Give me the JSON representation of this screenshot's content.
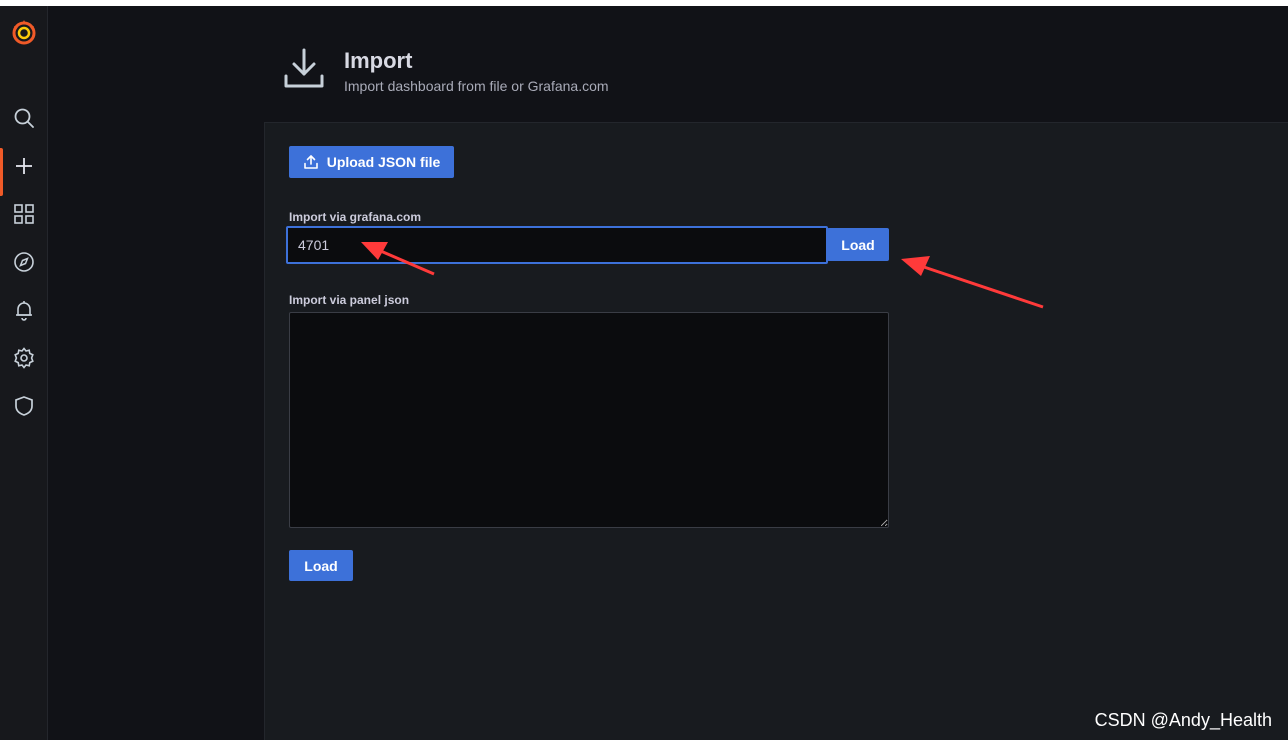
{
  "sidebar": {
    "icons": [
      "grafana-logo",
      "search-icon",
      "plus-icon",
      "dashboards-icon",
      "explore-icon",
      "alerting-icon",
      "configuration-icon",
      "shield-icon"
    ],
    "accent_color": "#f05a28"
  },
  "header": {
    "title": "Import",
    "subtitle": "Import dashboard from file or Grafana.com"
  },
  "upload": {
    "label": "Upload JSON file"
  },
  "grafana_com": {
    "label": "Import via grafana.com",
    "value": "4701",
    "load_label": "Load"
  },
  "panel_json": {
    "label": "Import via panel json",
    "value": "",
    "load_label": "Load"
  },
  "colors": {
    "primary_button": "#3d71d9",
    "annotation_arrow": "#ff3a3a"
  },
  "watermark": "CSDN @Andy_Health"
}
